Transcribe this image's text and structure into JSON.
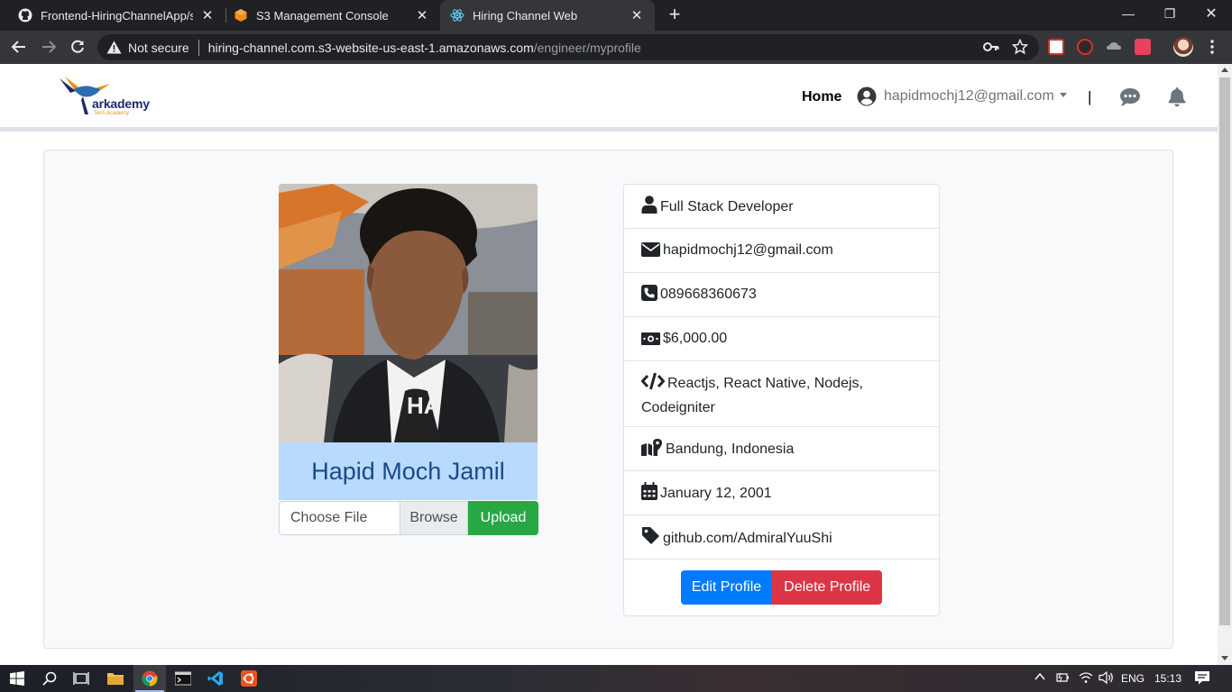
{
  "browser": {
    "tabs": [
      {
        "title": "Frontend-HiringChannelApp/src/",
        "icon": "github-icon"
      },
      {
        "title": "S3 Management Console",
        "icon": "aws-icon"
      },
      {
        "title": "Hiring Channel Web",
        "icon": "react-icon",
        "active": true
      }
    ],
    "omnibox": {
      "security": "Not secure",
      "host": "hiring-channel.com.s3-website-us-east-1.amazonaws.com",
      "path": "/engineer/myprofile"
    }
  },
  "navbar": {
    "logo_text": "arkademy",
    "logo_sub": "Tech Academy",
    "home": "Home",
    "user_email": "hapidmochj12@gmail.com",
    "separator": "|"
  },
  "profile": {
    "name": "Hapid Moch Jamil",
    "upload": {
      "placeholder": "Choose File",
      "browse": "Browse",
      "upload": "Upload"
    },
    "details": [
      {
        "icon": "user-icon",
        "text": "Full Stack Developer"
      },
      {
        "icon": "envelope-icon",
        "text": "hapidmochj12@gmail.com"
      },
      {
        "icon": "phone-icon",
        "text": "089668360673"
      },
      {
        "icon": "money-icon",
        "text": "$6,000.00"
      },
      {
        "icon": "code-icon",
        "text": "Reactjs, React Native, Nodejs, Codeigniter"
      },
      {
        "icon": "map-icon",
        "text": "Bandung, Indonesia"
      },
      {
        "icon": "calendar-icon",
        "text": "January 12, 2001"
      },
      {
        "icon": "tag-icon",
        "text": "github.com/AdmiralYuuShi"
      }
    ],
    "actions": {
      "edit": "Edit Profile",
      "delete": "Delete Profile"
    }
  },
  "taskbar": {
    "language": "ENG",
    "time": "15:13"
  }
}
